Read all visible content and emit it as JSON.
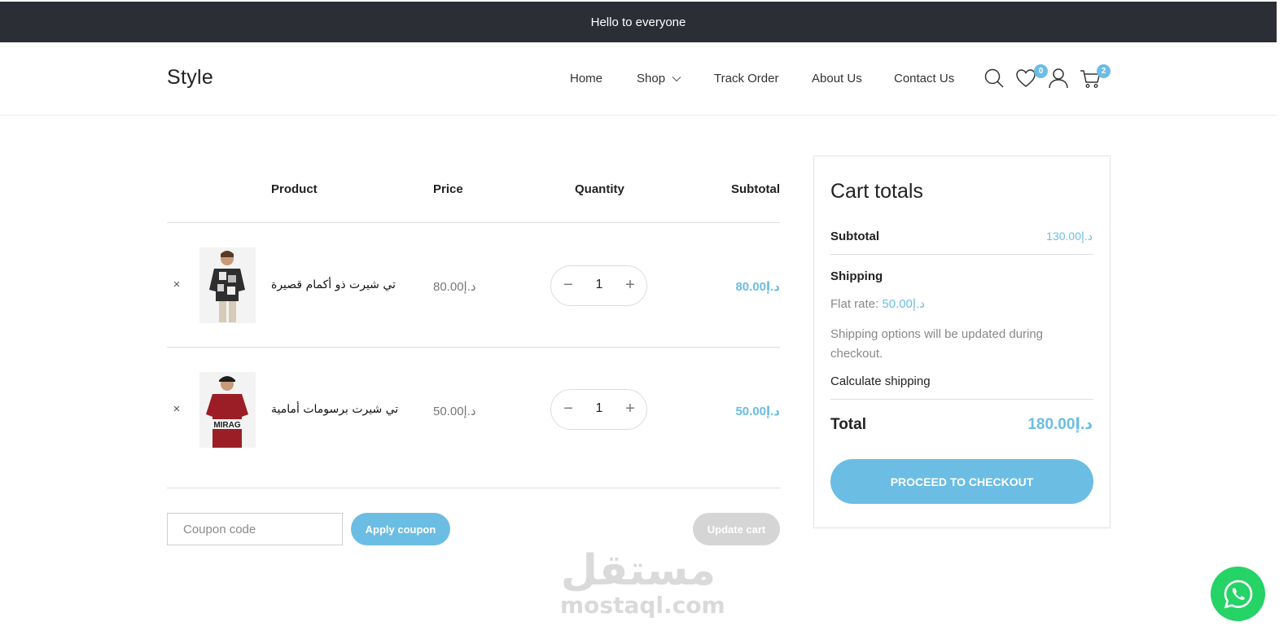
{
  "announcement": "Hello to everyone",
  "header": {
    "logo": "Style",
    "nav": {
      "home": "Home",
      "shop": "Shop",
      "track": "Track Order",
      "about": "About Us",
      "contact": "Contact Us"
    },
    "icons": [
      "search-icon",
      "wishlist-heart-icon",
      "account-user-icon",
      "cart-icon"
    ],
    "wishlist_count": "0",
    "cart_count": "2"
  },
  "cart": {
    "columns": {
      "product": "Product",
      "price": "Price",
      "quantity": "Quantity",
      "subtotal": "Subtotal"
    },
    "items": [
      {
        "remove": "×",
        "name": "تي شيرت ذو أكمام قصيرة",
        "price": "د.إ80.00",
        "quantity": "1",
        "subtotal": "د.إ80.00"
      },
      {
        "remove": "×",
        "name": "تي شيرت برسومات أمامية",
        "price": "د.إ50.00",
        "quantity": "1",
        "subtotal": "د.إ50.00"
      }
    ],
    "coupon_placeholder": "Coupon code",
    "apply_coupon": "Apply coupon",
    "update_cart": "Update cart"
  },
  "totals": {
    "title": "Cart totals",
    "subtotal_label": "Subtotal",
    "subtotal_value": "د.إ130.00",
    "shipping_label": "Shipping",
    "flat_rate_label": "Flat rate:",
    "flat_rate_value": "د.إ50.00",
    "shipping_note": "Shipping options will be updated during checkout.",
    "calculate_shipping": "Calculate shipping",
    "total_label": "Total",
    "total_value": "د.إ180.00",
    "checkout": "PROCEED TO CHECKOUT"
  },
  "watermark": {
    "arabic": "مستقل",
    "latin": "mostaql.com"
  },
  "colors": {
    "accent": "#6bbde3",
    "topbar": "#2b2e35",
    "whatsapp": "#25d366",
    "disabled_button": "#d5d5d5"
  }
}
